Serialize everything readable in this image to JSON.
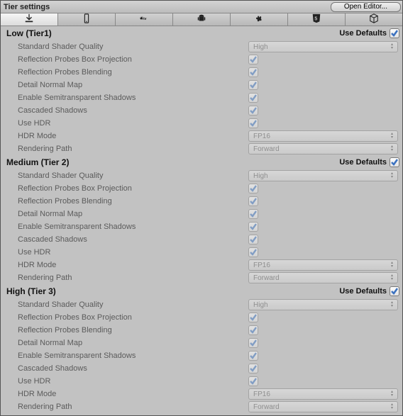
{
  "header": {
    "title": "Tier settings",
    "open_editor": "Open Editor..."
  },
  "tabs": [
    {
      "icon": "download",
      "selected": true
    },
    {
      "icon": "tablet",
      "selected": false
    },
    {
      "icon": "apple-tv",
      "selected": false
    },
    {
      "icon": "android",
      "selected": false
    },
    {
      "icon": "fan",
      "selected": false
    },
    {
      "icon": "html5",
      "selected": false
    },
    {
      "icon": "cube",
      "selected": false
    }
  ],
  "use_defaults_label": "Use Defaults",
  "tiers": [
    {
      "title": "Low (Tier1)",
      "use_defaults": true,
      "rows": [
        {
          "label": "Standard Shader Quality",
          "type": "select",
          "value": "High"
        },
        {
          "label": "Reflection Probes Box Projection",
          "type": "checkbox",
          "checked": true
        },
        {
          "label": "Reflection Probes Blending",
          "type": "checkbox",
          "checked": true
        },
        {
          "label": "Detail Normal Map",
          "type": "checkbox",
          "checked": true
        },
        {
          "label": "Enable Semitransparent Shadows",
          "type": "checkbox",
          "checked": true
        },
        {
          "label": "Cascaded Shadows",
          "type": "checkbox",
          "checked": true
        },
        {
          "label": "Use HDR",
          "type": "checkbox",
          "checked": true
        },
        {
          "label": "HDR Mode",
          "type": "select",
          "value": "FP16"
        },
        {
          "label": "Rendering Path",
          "type": "select",
          "value": "Forward"
        }
      ]
    },
    {
      "title": "Medium (Tier 2)",
      "use_defaults": true,
      "rows": [
        {
          "label": "Standard Shader Quality",
          "type": "select",
          "value": "High"
        },
        {
          "label": "Reflection Probes Box Projection",
          "type": "checkbox",
          "checked": true
        },
        {
          "label": "Reflection Probes Blending",
          "type": "checkbox",
          "checked": true
        },
        {
          "label": "Detail Normal Map",
          "type": "checkbox",
          "checked": true
        },
        {
          "label": "Enable Semitransparent Shadows",
          "type": "checkbox",
          "checked": true
        },
        {
          "label": "Cascaded Shadows",
          "type": "checkbox",
          "checked": true
        },
        {
          "label": "Use HDR",
          "type": "checkbox",
          "checked": true
        },
        {
          "label": "HDR Mode",
          "type": "select",
          "value": "FP16"
        },
        {
          "label": "Rendering Path",
          "type": "select",
          "value": "Forward"
        }
      ]
    },
    {
      "title": "High (Tier 3)",
      "use_defaults": true,
      "rows": [
        {
          "label": "Standard Shader Quality",
          "type": "select",
          "value": "High"
        },
        {
          "label": "Reflection Probes Box Projection",
          "type": "checkbox",
          "checked": true
        },
        {
          "label": "Reflection Probes Blending",
          "type": "checkbox",
          "checked": true
        },
        {
          "label": "Detail Normal Map",
          "type": "checkbox",
          "checked": true
        },
        {
          "label": "Enable Semitransparent Shadows",
          "type": "checkbox",
          "checked": true
        },
        {
          "label": "Cascaded Shadows",
          "type": "checkbox",
          "checked": true
        },
        {
          "label": "Use HDR",
          "type": "checkbox",
          "checked": true
        },
        {
          "label": "HDR Mode",
          "type": "select",
          "value": "FP16"
        },
        {
          "label": "Rendering Path",
          "type": "select",
          "value": "Forward"
        }
      ]
    }
  ]
}
